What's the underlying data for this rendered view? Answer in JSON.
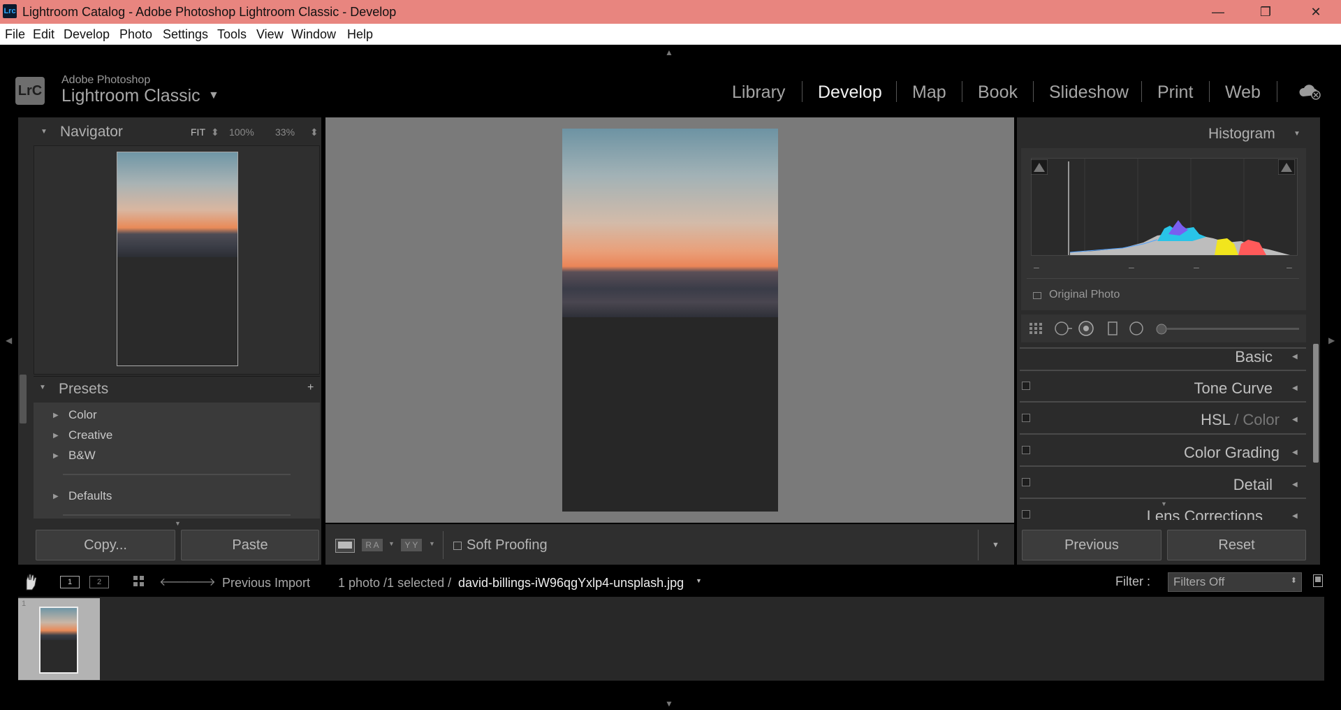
{
  "titlebar": {
    "logo": "Lrc",
    "title": "Lightroom Catalog - Adobe Photoshop Lightroom Classic - Develop",
    "minimize": "—",
    "restore": "❐",
    "close": "✕"
  },
  "menu": [
    "File",
    "Edit",
    "Develop",
    "Photo",
    "Settings",
    "Tools",
    "View",
    "Window",
    "Help"
  ],
  "brand": {
    "badge": "LrC",
    "small": "Adobe Photoshop",
    "big": "Lightroom Classic",
    "arrow": "▼"
  },
  "modules": [
    "Library",
    "Develop",
    "Map",
    "Book",
    "Slideshow",
    "Print",
    "Web"
  ],
  "active_module": "Develop",
  "navigator": {
    "title": "Navigator",
    "fit": "FIT",
    "z1": "100%",
    "z2": "33%"
  },
  "presets": {
    "title": "Presets",
    "add": "+",
    "items": [
      "Color",
      "Creative",
      "B&W",
      "Defaults"
    ]
  },
  "left_buttons": {
    "copy": "Copy...",
    "paste": "Paste"
  },
  "toolbar": {
    "soft_proofing": "Soft Proofing",
    "ra": "R A",
    "yy": "Y Y"
  },
  "histogram": {
    "title": "Histogram",
    "original_photo": "Original Photo"
  },
  "sections": {
    "basic": "Basic",
    "tone_curve": "Tone Curve",
    "hsl": "HSL",
    "hsl_sep": " / ",
    "color": "Color",
    "color_grading": "Color Grading",
    "detail": "Detail",
    "lens": "Lens Corrections"
  },
  "right_buttons": {
    "previous": "Previous",
    "reset": "Reset"
  },
  "filmbar": {
    "source": "Previous Import",
    "count": "1 photo /1 selected /",
    "filename": "david-billings-iW96qgYxlp4-unsplash.jpg",
    "filter_label": "Filter :",
    "filter_value": "Filters Off",
    "page1": "1",
    "page2": "2",
    "thumb_index": "1"
  },
  "colors": {
    "titlebar": "#e8857f",
    "panel": "#2b2b2b",
    "center": "#7a7a7a"
  }
}
